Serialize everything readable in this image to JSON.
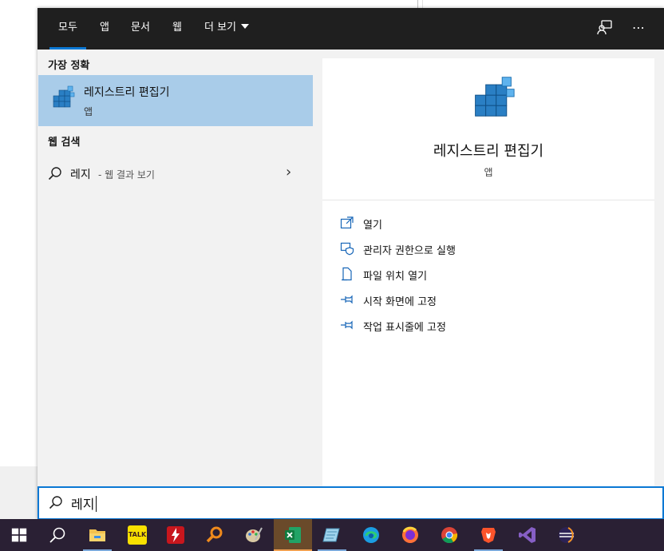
{
  "tabs": [
    {
      "label": "모두",
      "active": true
    },
    {
      "label": "앱"
    },
    {
      "label": "문서"
    },
    {
      "label": "웹"
    },
    {
      "label": "더 보기"
    }
  ],
  "icons": {
    "feedback": "feedback-person-icon",
    "more": "⋯"
  },
  "best_match": {
    "heading": "가장 정확",
    "title": "레지스트리 편집기",
    "subtitle": "앱"
  },
  "web_search": {
    "heading": "웹 검색",
    "query": "레지",
    "hint": "- 웹 결과 보기"
  },
  "detail": {
    "title": "레지스트리 편집기",
    "subtitle": "앱",
    "actions": [
      {
        "label": "열기",
        "icon": "open-icon"
      },
      {
        "label": "관리자 권한으로 실행",
        "icon": "shield-icon"
      },
      {
        "label": "파일 위치 열기",
        "icon": "file-location-icon"
      },
      {
        "label": "시작 화면에 고정",
        "icon": "pin-icon"
      },
      {
        "label": "작업 표시줄에 고정",
        "icon": "pin-icon"
      }
    ]
  },
  "search": {
    "value": "레지"
  },
  "taskbar": {
    "items": [
      {
        "name": "start",
        "icon": "windows-icon"
      },
      {
        "name": "search",
        "icon": "search-icon"
      },
      {
        "name": "file-explorer",
        "icon": "folder-icon",
        "running": true
      },
      {
        "name": "kakaotalk",
        "icon": "kakaotalk-icon",
        "glyph": "TALK"
      },
      {
        "name": "flash-app",
        "icon": "lightning-icon"
      },
      {
        "name": "search-tool",
        "icon": "magnifier-icon"
      },
      {
        "name": "paint",
        "icon": "palette-icon"
      },
      {
        "name": "excel",
        "icon": "excel-icon",
        "active": true
      },
      {
        "name": "notes",
        "icon": "notepad-icon",
        "running": true
      },
      {
        "name": "edge",
        "icon": "edge-icon"
      },
      {
        "name": "firefox",
        "icon": "firefox-icon"
      },
      {
        "name": "chrome",
        "icon": "chrome-icon"
      },
      {
        "name": "brave",
        "icon": "brave-icon",
        "running": true
      },
      {
        "name": "visual-studio",
        "icon": "visual-studio-icon"
      },
      {
        "name": "eclipse",
        "icon": "eclipse-icon"
      }
    ]
  },
  "colors": {
    "accent": "#0a78d4",
    "selection": "#a9cce9",
    "topbar": "#1f1f1f",
    "taskbar": "#2a2034"
  }
}
